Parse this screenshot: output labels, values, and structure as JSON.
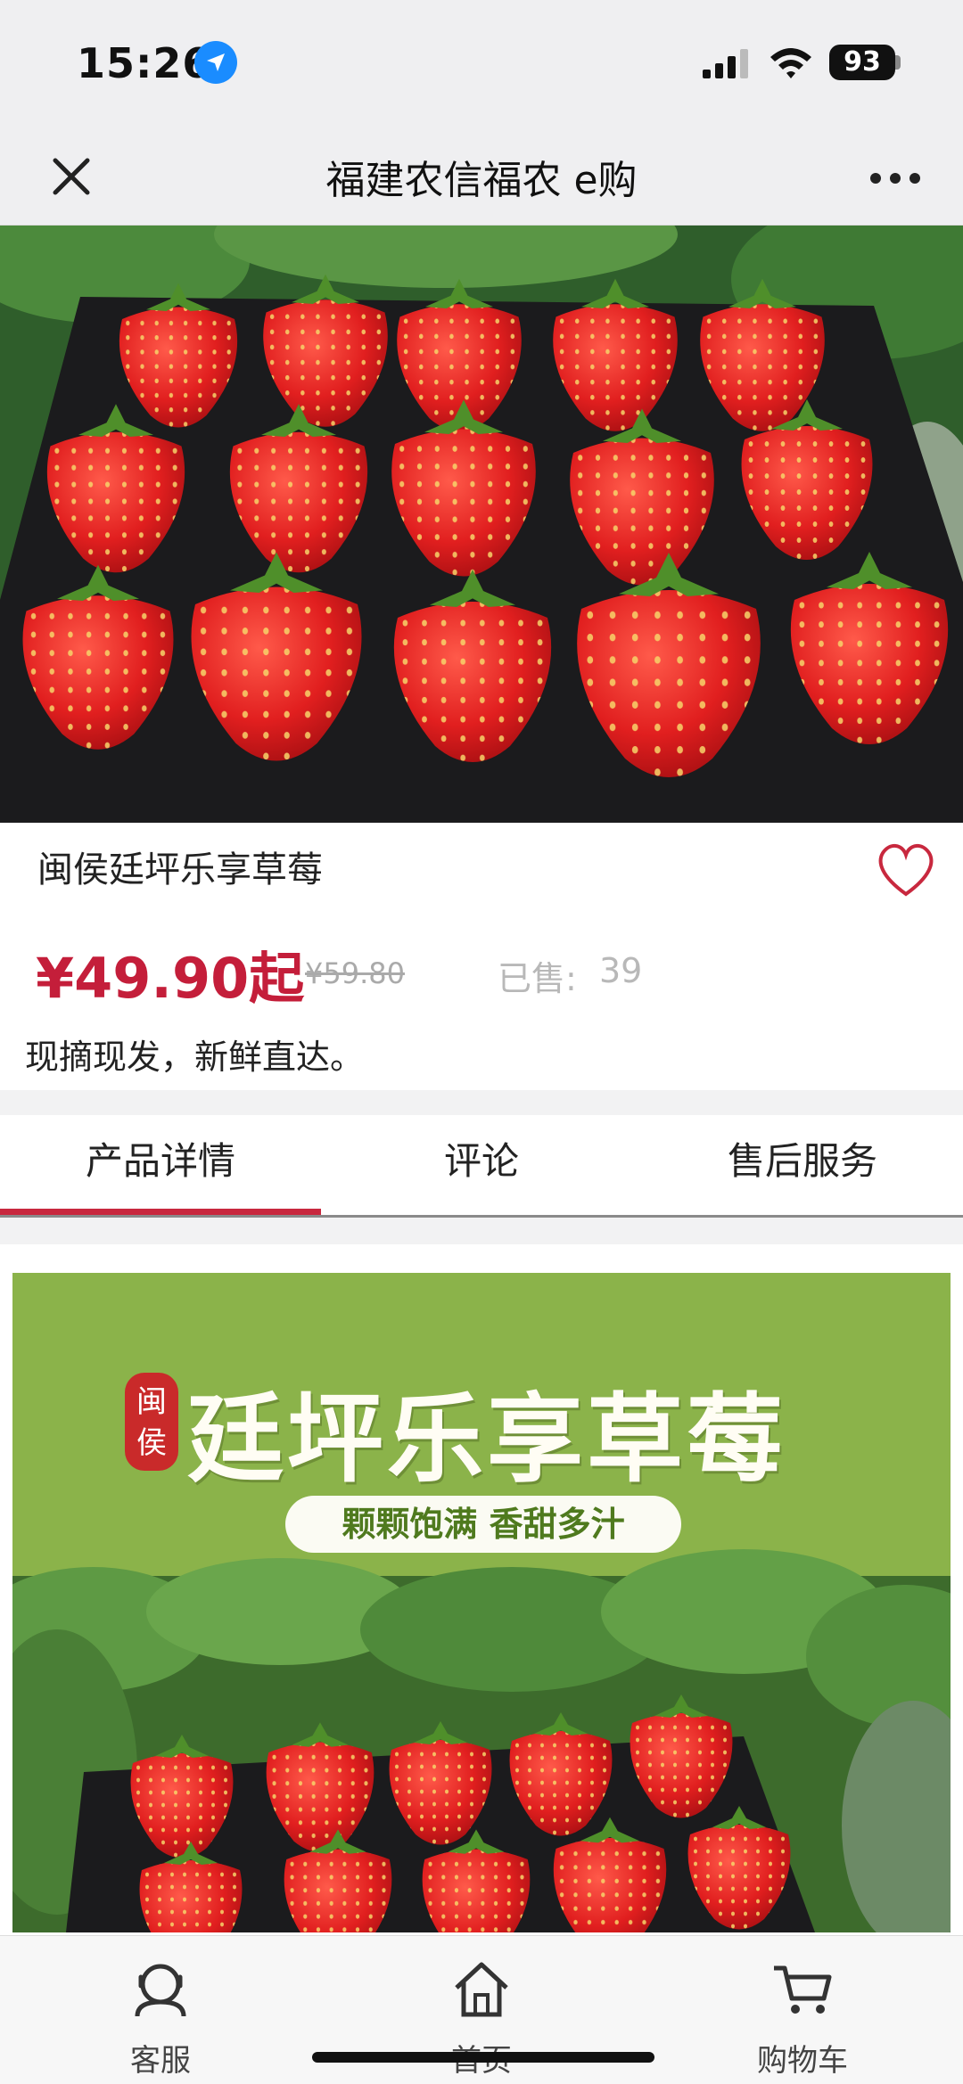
{
  "status_bar": {
    "time": "15:26",
    "battery": "93"
  },
  "nav": {
    "title": "福建农信福农 e购"
  },
  "product": {
    "name": "闽侯廷坪乐享草莓",
    "price": "¥49.90起",
    "original_price": "¥59.80",
    "sold_label": "已售:",
    "sold_count": "39",
    "description": "现摘现发，新鲜直达。"
  },
  "tabs": [
    {
      "label": "产品详情",
      "active": true
    },
    {
      "label": "评论",
      "active": false
    },
    {
      "label": "售后服务",
      "active": false
    }
  ],
  "detail_banner": {
    "seal": "闽侯",
    "title": "廷坪乐享草莓",
    "slogan": "颗颗饱满  香甜多汁"
  },
  "bottom_nav": [
    {
      "label": "客服",
      "icon": "customer-service-icon"
    },
    {
      "label": "首页",
      "icon": "home-icon"
    },
    {
      "label": "购物车",
      "icon": "cart-icon"
    }
  ],
  "colors": {
    "price": "#c41e3a",
    "tab_indicator": "#c8283e",
    "banner_green": "#8bb34a"
  }
}
